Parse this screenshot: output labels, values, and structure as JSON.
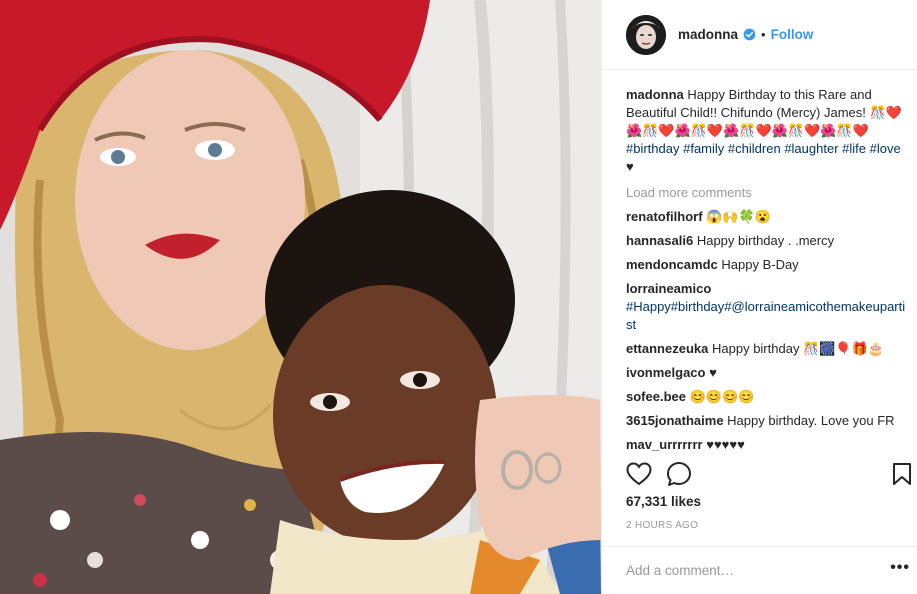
{
  "post": {
    "image_alt": "Madonna in a red hat with her daughter Mercy",
    "author": {
      "username": "madonna",
      "verified": true
    },
    "follow_label": "Follow",
    "dot": "•",
    "caption": {
      "username": "madonna",
      "text_1": "Happy Birthday to this Rare and Beautiful Child!! Chifundo (Mercy) James!",
      "emoji_line": "🎊❤️🌺🎊❤️🌺🎊❤️🌺🎊❤️🌺🎊❤️🌺🎊❤️",
      "hashtags": [
        "#birthday",
        "#family",
        "#children",
        "#laughter",
        "#life",
        "#love"
      ],
      "trailing": "♥"
    },
    "load_more_label": "Load more comments",
    "comments": [
      {
        "user": "renatofilhorf",
        "text": "😱🙌🍀😮"
      },
      {
        "user": "hannasali6",
        "text": "Happy birthday . .mercy"
      },
      {
        "user": "mendoncamdc",
        "text": "Happy B-Day"
      },
      {
        "user": "lorraineamico",
        "text": "#Happy#birthday#@lorraineamicothemakeupartist"
      },
      {
        "user": "ettannezeuka",
        "text": "Happy birthday 🎊🎆🎈🎁🎂"
      },
      {
        "user": "ivonmelgaco",
        "text": "♥"
      },
      {
        "user": "sofee.bee",
        "text": "😊😊😊😊"
      },
      {
        "user": "3615jonathaime",
        "text": "Happy birthday. Love you FR"
      },
      {
        "user": "mav_urrrrrrr",
        "text": "♥♥♥♥♥"
      }
    ],
    "likes": "67,331 likes",
    "time": "2 HOURS AGO",
    "add_comment_placeholder": "Add a comment…",
    "more_label": "•••",
    "icons": {
      "like": "heart-icon",
      "comment": "speech-bubble-icon",
      "save": "bookmark-icon",
      "verified": "verified-badge-icon"
    },
    "colors": {
      "link": "#3897f0",
      "hashtag": "#003569",
      "muted": "#999999",
      "hat": "#c8192b",
      "lips": "#c2202d"
    }
  }
}
